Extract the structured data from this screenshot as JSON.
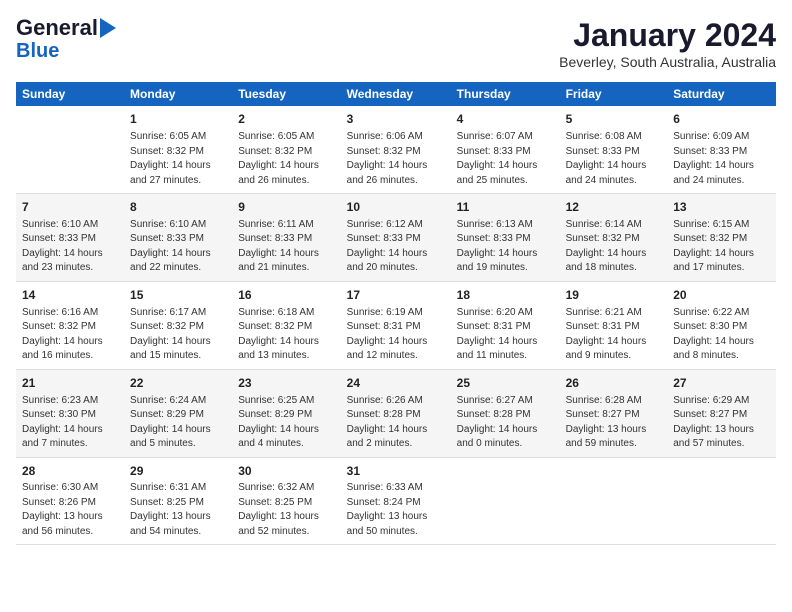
{
  "header": {
    "logo_line1": "General",
    "logo_line2": "Blue",
    "month": "January 2024",
    "location": "Beverley, South Australia, Australia"
  },
  "weekdays": [
    "Sunday",
    "Monday",
    "Tuesday",
    "Wednesday",
    "Thursday",
    "Friday",
    "Saturday"
  ],
  "weeks": [
    [
      {
        "num": "",
        "info": ""
      },
      {
        "num": "1",
        "info": "Sunrise: 6:05 AM\nSunset: 8:32 PM\nDaylight: 14 hours\nand 27 minutes."
      },
      {
        "num": "2",
        "info": "Sunrise: 6:05 AM\nSunset: 8:32 PM\nDaylight: 14 hours\nand 26 minutes."
      },
      {
        "num": "3",
        "info": "Sunrise: 6:06 AM\nSunset: 8:32 PM\nDaylight: 14 hours\nand 26 minutes."
      },
      {
        "num": "4",
        "info": "Sunrise: 6:07 AM\nSunset: 8:33 PM\nDaylight: 14 hours\nand 25 minutes."
      },
      {
        "num": "5",
        "info": "Sunrise: 6:08 AM\nSunset: 8:33 PM\nDaylight: 14 hours\nand 24 minutes."
      },
      {
        "num": "6",
        "info": "Sunrise: 6:09 AM\nSunset: 8:33 PM\nDaylight: 14 hours\nand 24 minutes."
      }
    ],
    [
      {
        "num": "7",
        "info": "Sunrise: 6:10 AM\nSunset: 8:33 PM\nDaylight: 14 hours\nand 23 minutes."
      },
      {
        "num": "8",
        "info": "Sunrise: 6:10 AM\nSunset: 8:33 PM\nDaylight: 14 hours\nand 22 minutes."
      },
      {
        "num": "9",
        "info": "Sunrise: 6:11 AM\nSunset: 8:33 PM\nDaylight: 14 hours\nand 21 minutes."
      },
      {
        "num": "10",
        "info": "Sunrise: 6:12 AM\nSunset: 8:33 PM\nDaylight: 14 hours\nand 20 minutes."
      },
      {
        "num": "11",
        "info": "Sunrise: 6:13 AM\nSunset: 8:33 PM\nDaylight: 14 hours\nand 19 minutes."
      },
      {
        "num": "12",
        "info": "Sunrise: 6:14 AM\nSunset: 8:32 PM\nDaylight: 14 hours\nand 18 minutes."
      },
      {
        "num": "13",
        "info": "Sunrise: 6:15 AM\nSunset: 8:32 PM\nDaylight: 14 hours\nand 17 minutes."
      }
    ],
    [
      {
        "num": "14",
        "info": "Sunrise: 6:16 AM\nSunset: 8:32 PM\nDaylight: 14 hours\nand 16 minutes."
      },
      {
        "num": "15",
        "info": "Sunrise: 6:17 AM\nSunset: 8:32 PM\nDaylight: 14 hours\nand 15 minutes."
      },
      {
        "num": "16",
        "info": "Sunrise: 6:18 AM\nSunset: 8:32 PM\nDaylight: 14 hours\nand 13 minutes."
      },
      {
        "num": "17",
        "info": "Sunrise: 6:19 AM\nSunset: 8:31 PM\nDaylight: 14 hours\nand 12 minutes."
      },
      {
        "num": "18",
        "info": "Sunrise: 6:20 AM\nSunset: 8:31 PM\nDaylight: 14 hours\nand 11 minutes."
      },
      {
        "num": "19",
        "info": "Sunrise: 6:21 AM\nSunset: 8:31 PM\nDaylight: 14 hours\nand 9 minutes."
      },
      {
        "num": "20",
        "info": "Sunrise: 6:22 AM\nSunset: 8:30 PM\nDaylight: 14 hours\nand 8 minutes."
      }
    ],
    [
      {
        "num": "21",
        "info": "Sunrise: 6:23 AM\nSunset: 8:30 PM\nDaylight: 14 hours\nand 7 minutes."
      },
      {
        "num": "22",
        "info": "Sunrise: 6:24 AM\nSunset: 8:29 PM\nDaylight: 14 hours\nand 5 minutes."
      },
      {
        "num": "23",
        "info": "Sunrise: 6:25 AM\nSunset: 8:29 PM\nDaylight: 14 hours\nand 4 minutes."
      },
      {
        "num": "24",
        "info": "Sunrise: 6:26 AM\nSunset: 8:28 PM\nDaylight: 14 hours\nand 2 minutes."
      },
      {
        "num": "25",
        "info": "Sunrise: 6:27 AM\nSunset: 8:28 PM\nDaylight: 14 hours\nand 0 minutes."
      },
      {
        "num": "26",
        "info": "Sunrise: 6:28 AM\nSunset: 8:27 PM\nDaylight: 13 hours\nand 59 minutes."
      },
      {
        "num": "27",
        "info": "Sunrise: 6:29 AM\nSunset: 8:27 PM\nDaylight: 13 hours\nand 57 minutes."
      }
    ],
    [
      {
        "num": "28",
        "info": "Sunrise: 6:30 AM\nSunset: 8:26 PM\nDaylight: 13 hours\nand 56 minutes."
      },
      {
        "num": "29",
        "info": "Sunrise: 6:31 AM\nSunset: 8:25 PM\nDaylight: 13 hours\nand 54 minutes."
      },
      {
        "num": "30",
        "info": "Sunrise: 6:32 AM\nSunset: 8:25 PM\nDaylight: 13 hours\nand 52 minutes."
      },
      {
        "num": "31",
        "info": "Sunrise: 6:33 AM\nSunset: 8:24 PM\nDaylight: 13 hours\nand 50 minutes."
      },
      {
        "num": "",
        "info": ""
      },
      {
        "num": "",
        "info": ""
      },
      {
        "num": "",
        "info": ""
      }
    ]
  ]
}
